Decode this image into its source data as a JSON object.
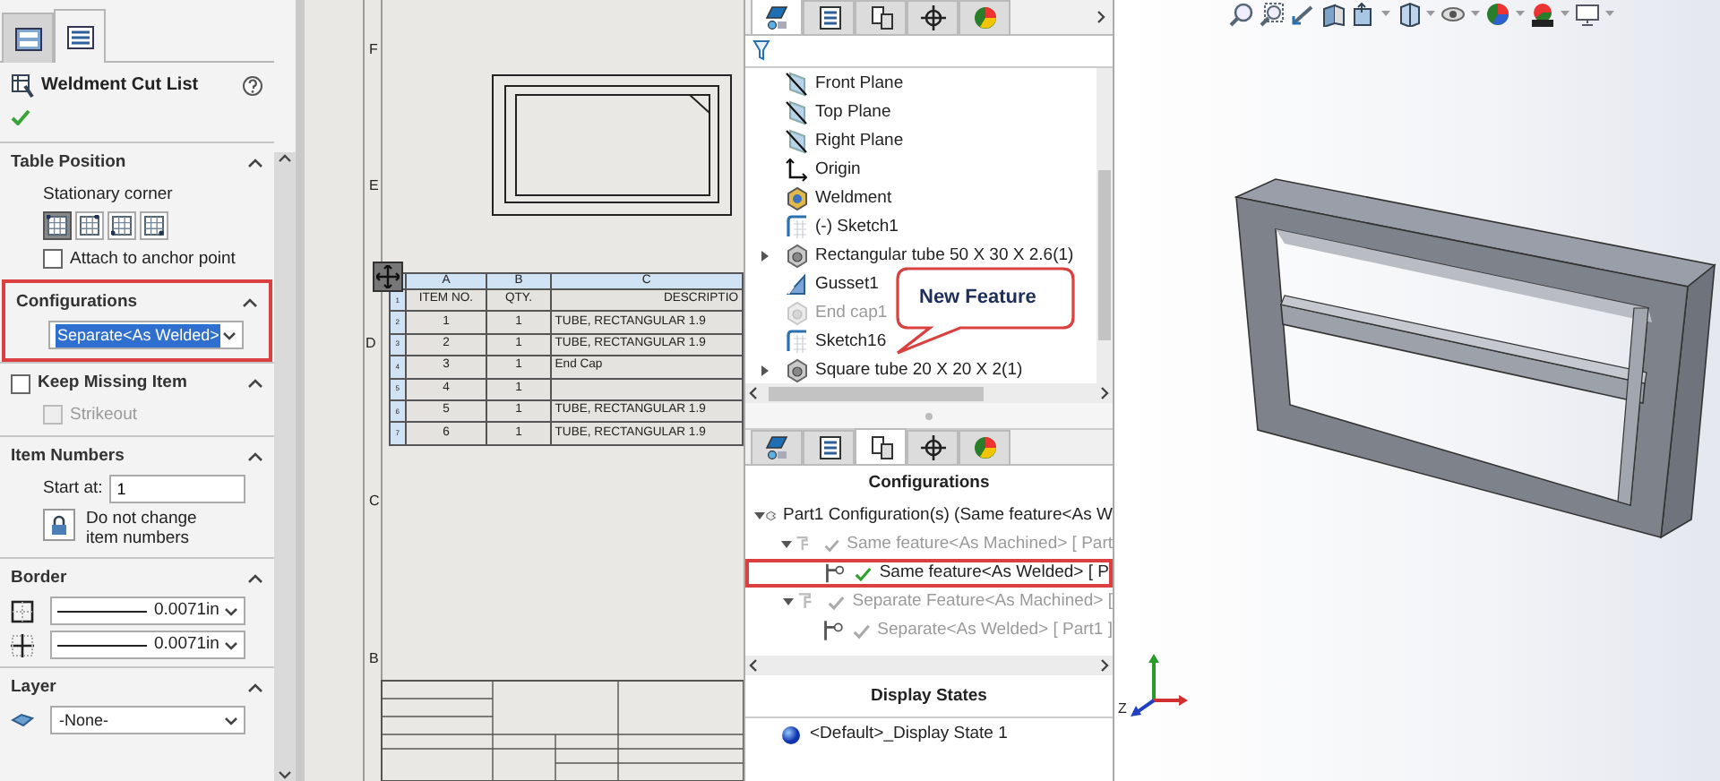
{
  "property_manager": {
    "tabs": [
      {
        "selected": false
      },
      {
        "selected": true
      }
    ],
    "title": "Weldment Cut List",
    "sections": [
      {
        "kind": "table_position",
        "title": "Table Position",
        "highlighted": false,
        "corner_label": "Stationary corner",
        "corners": [
          {
            "selected": true
          },
          {
            "selected": false
          },
          {
            "selected": false
          },
          {
            "selected": false
          }
        ],
        "anchor": {
          "label": "Attach to anchor point",
          "checked": false
        }
      },
      {
        "kind": "configurations",
        "title": "Configurations",
        "highlighted": true,
        "value": "Separate<As Welded>",
        "value_selected": true
      },
      {
        "kind": "keep_missing",
        "title": "Keep Missing Item",
        "highlighted": false,
        "checked": false,
        "strikeout": {
          "label": "Strikeout",
          "checked": false,
          "disabled": true
        }
      },
      {
        "kind": "item_numbers",
        "title": "Item Numbers",
        "highlighted": false,
        "start_label": "Start at:",
        "start_value": "1",
        "lock_label": "Do not change item numbers"
      },
      {
        "kind": "border",
        "title": "Border",
        "highlighted": false,
        "values": [
          "0.0071in",
          "0.0071in"
        ]
      },
      {
        "kind": "layer",
        "title": "Layer",
        "highlighted": false,
        "value": "-None-"
      }
    ]
  },
  "drawing": {
    "zone_labels": [
      "F",
      "E",
      "D",
      "C",
      "B"
    ],
    "cut_list": {
      "columns": [
        "A",
        "B",
        "C"
      ],
      "row_numbers": [
        "1",
        "2",
        "3",
        "4",
        "5",
        "6",
        "7"
      ],
      "rows": [
        [
          "ITEM NO.",
          "QTY.",
          "DESCRIPTIO"
        ],
        [
          "1",
          "1",
          "TUBE, RECTANGULAR 1.9"
        ],
        [
          "2",
          "1",
          "TUBE, RECTANGULAR 1.9"
        ],
        [
          "3",
          "1",
          "End Cap"
        ],
        [
          "4",
          "1"
        ],
        [
          "5",
          "1",
          "TUBE, RECTANGULAR 1.9"
        ],
        [
          "6",
          "1",
          "TUBE, RECTANGULAR 1.9"
        ]
      ]
    }
  },
  "feature_tree": {
    "tabs": [
      {
        "selected": true
      },
      {
        "selected": false
      },
      {
        "selected": false
      },
      {
        "selected": false
      },
      {
        "selected": false
      }
    ],
    "items": [
      {
        "label": "Front Plane",
        "kind": "plane",
        "suppressed": false
      },
      {
        "label": "Top Plane",
        "kind": "plane",
        "suppressed": false
      },
      {
        "label": "Right Plane",
        "kind": "plane",
        "suppressed": false
      },
      {
        "label": "Origin",
        "kind": "origin",
        "suppressed": false
      },
      {
        "label": "Weldment",
        "kind": "weldment",
        "suppressed": false
      },
      {
        "label": "(-) Sketch1",
        "kind": "sketch",
        "suppressed": false
      },
      {
        "label": "Rectangular tube 50 X 30 X 2.6(1)",
        "kind": "member",
        "suppressed": false,
        "expanded": false
      },
      {
        "label": "Gusset1",
        "kind": "gusset",
        "suppressed": false
      },
      {
        "label": "End cap1",
        "kind": "member",
        "suppressed": true
      },
      {
        "label": "Sketch16",
        "kind": "sketch",
        "suppressed": false
      },
      {
        "label": "Square tube 20 X 20 X 2(1)",
        "kind": "member",
        "suppressed": false,
        "expanded": false
      }
    ]
  },
  "callout": {
    "text": "New Feature"
  },
  "configuration_manager": {
    "tabs": [
      {
        "selected": false
      },
      {
        "selected": false
      },
      {
        "selected": true
      },
      {
        "selected": false
      },
      {
        "selected": false
      }
    ],
    "title": "Configurations",
    "tree": [
      {
        "label": "Part1 Configuration(s)  (Same feature<As W",
        "kind": "part",
        "expanded": true,
        "children": [
          {
            "label": "Same feature<As Machined> [ Part",
            "kind": "group",
            "active": false,
            "highlighted": false,
            "expanded": true,
            "children": [
              {
                "label": "Same feature<As Welded> [ P",
                "kind": "config",
                "active": true,
                "highlighted": true
              }
            ]
          },
          {
            "label": "Separate Feature<As Machined> [",
            "kind": "group",
            "active": false,
            "highlighted": false,
            "expanded": true,
            "children": [
              {
                "label": "Separate<As Welded> [ Part1 ]",
                "kind": "config",
                "active": false,
                "highlighted": false
              }
            ]
          }
        ]
      }
    ],
    "display_states_title": "Display States",
    "display_states": [
      {
        "label": "<Default>_Display State 1"
      }
    ]
  },
  "viewport": {
    "triad_label": "Z"
  }
}
